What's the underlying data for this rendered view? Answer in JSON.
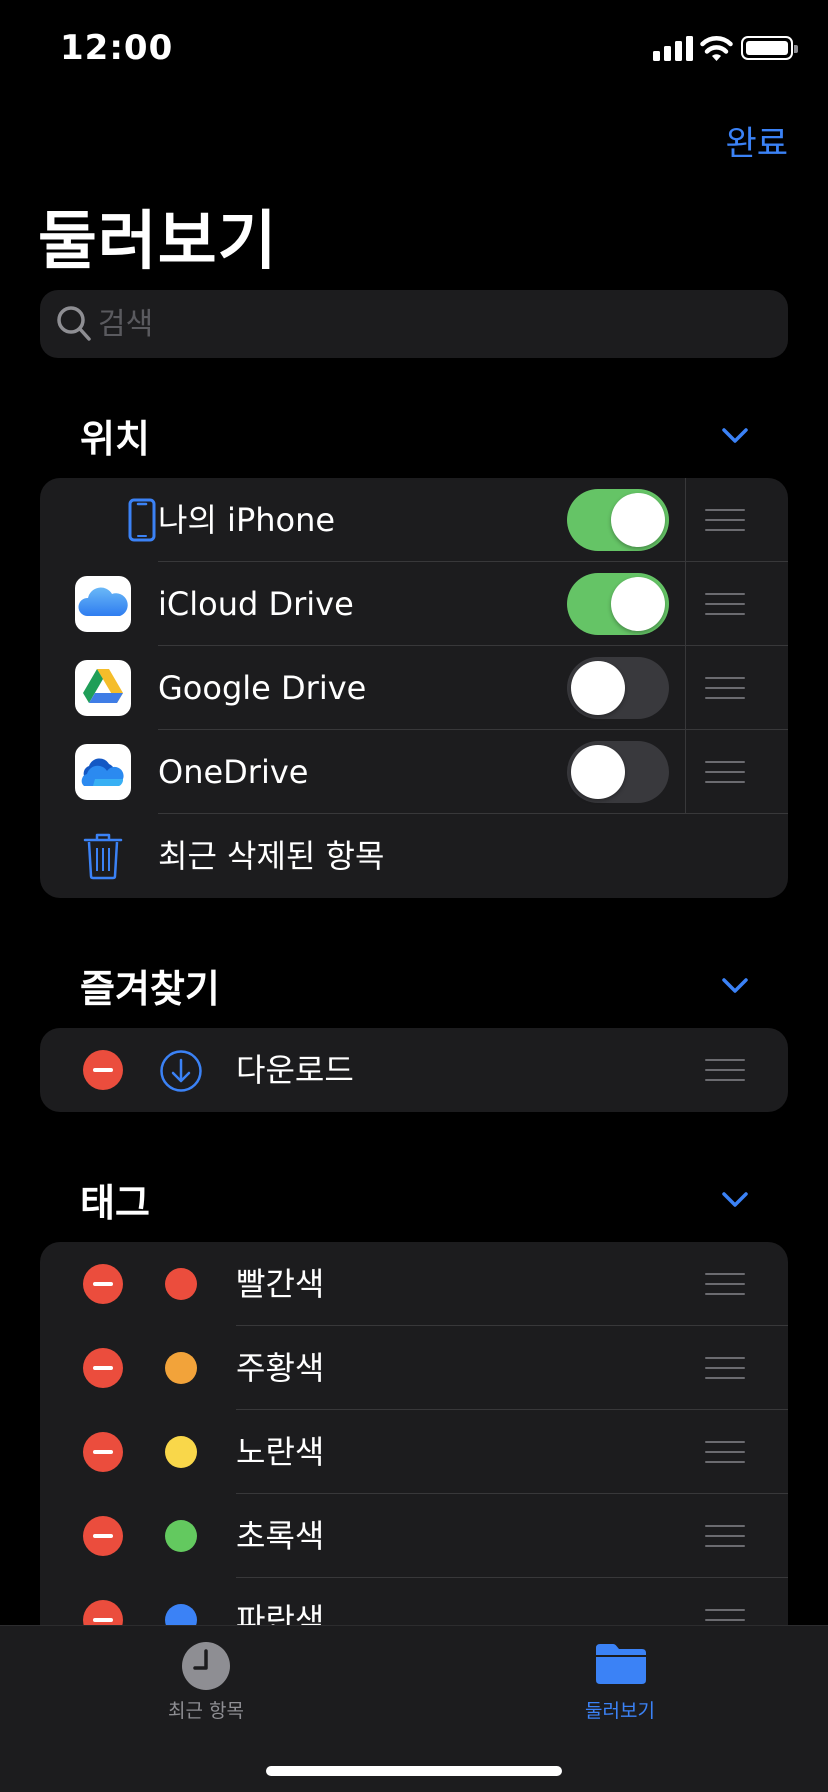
{
  "status_bar": {
    "time": "12:00"
  },
  "header": {
    "done_label": "완료",
    "title": "둘러보기"
  },
  "search": {
    "placeholder": "검색"
  },
  "locations": {
    "title": "위치",
    "items": [
      {
        "label": "나의 iPhone",
        "icon": "iphone-icon",
        "enabled": true
      },
      {
        "label": "iCloud Drive",
        "icon": "icloud-drive-icon",
        "enabled": true
      },
      {
        "label": "Google Drive",
        "icon": "google-drive-icon",
        "enabled": false
      },
      {
        "label": "OneDrive",
        "icon": "onedrive-icon",
        "enabled": false
      }
    ],
    "recently_deleted": {
      "label": "최근 삭제된 항목",
      "icon": "trash-icon"
    }
  },
  "favorites": {
    "title": "즐겨찾기",
    "items": [
      {
        "label": "다운로드",
        "icon": "download-icon"
      }
    ]
  },
  "tags": {
    "title": "태그",
    "items": [
      {
        "label": "빨간색",
        "color": "#eb4d3d"
      },
      {
        "label": "주황색",
        "color": "#f2a33a"
      },
      {
        "label": "노란색",
        "color": "#f9d74a"
      },
      {
        "label": "초록색",
        "color": "#63c95f"
      },
      {
        "label": "파란색",
        "color": "#3b82f6"
      }
    ]
  },
  "tab_bar": {
    "tabs": [
      {
        "label": "최근 항목",
        "icon": "clock-icon",
        "active": false
      },
      {
        "label": "둘러보기",
        "icon": "folder-icon",
        "active": true
      }
    ]
  },
  "colors": {
    "accent": "#3b82f6",
    "toggle_on": "#65c466",
    "delete": "#eb4d3d"
  }
}
